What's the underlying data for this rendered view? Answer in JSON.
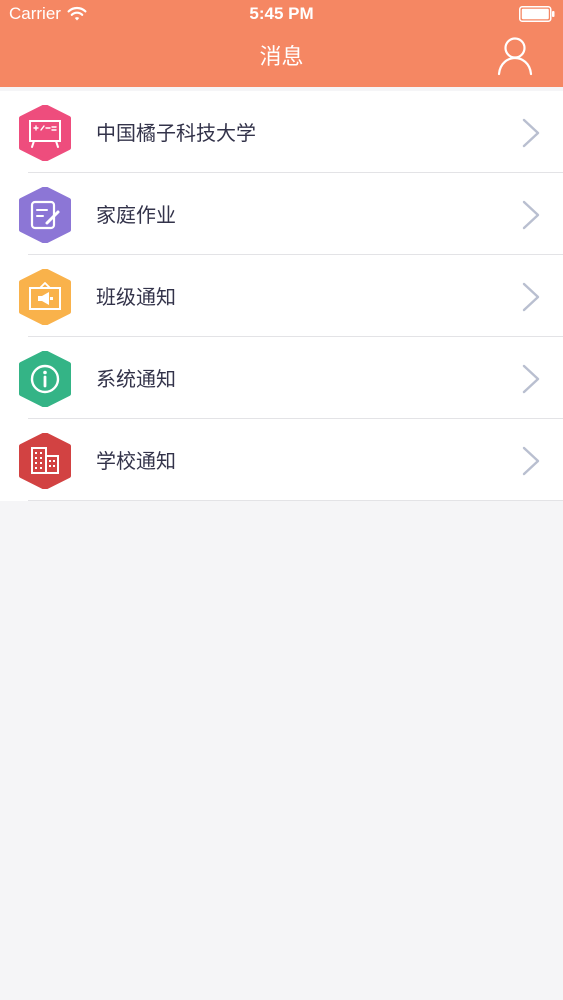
{
  "status_bar": {
    "carrier": "Carrier",
    "time": "5:45 PM"
  },
  "nav": {
    "title": "消息",
    "right_icon": "user-icon"
  },
  "colors": {
    "header": "#f58763",
    "background": "#f5f5f7",
    "text": "#33334a",
    "chevron": "#b9bfd0"
  },
  "list": {
    "items": [
      {
        "label": "中国橘子科技大学",
        "icon": "blackboard-icon",
        "color": "#ee4d7d"
      },
      {
        "label": "家庭作业",
        "icon": "homework-edit-icon",
        "color": "#8c76d6"
      },
      {
        "label": "班级通知",
        "icon": "megaphone-board-icon",
        "color": "#f9b24b"
      },
      {
        "label": "系统通知",
        "icon": "info-icon",
        "color": "#34b486"
      },
      {
        "label": "学校通知",
        "icon": "building-icon",
        "color": "#d24242"
      }
    ]
  }
}
